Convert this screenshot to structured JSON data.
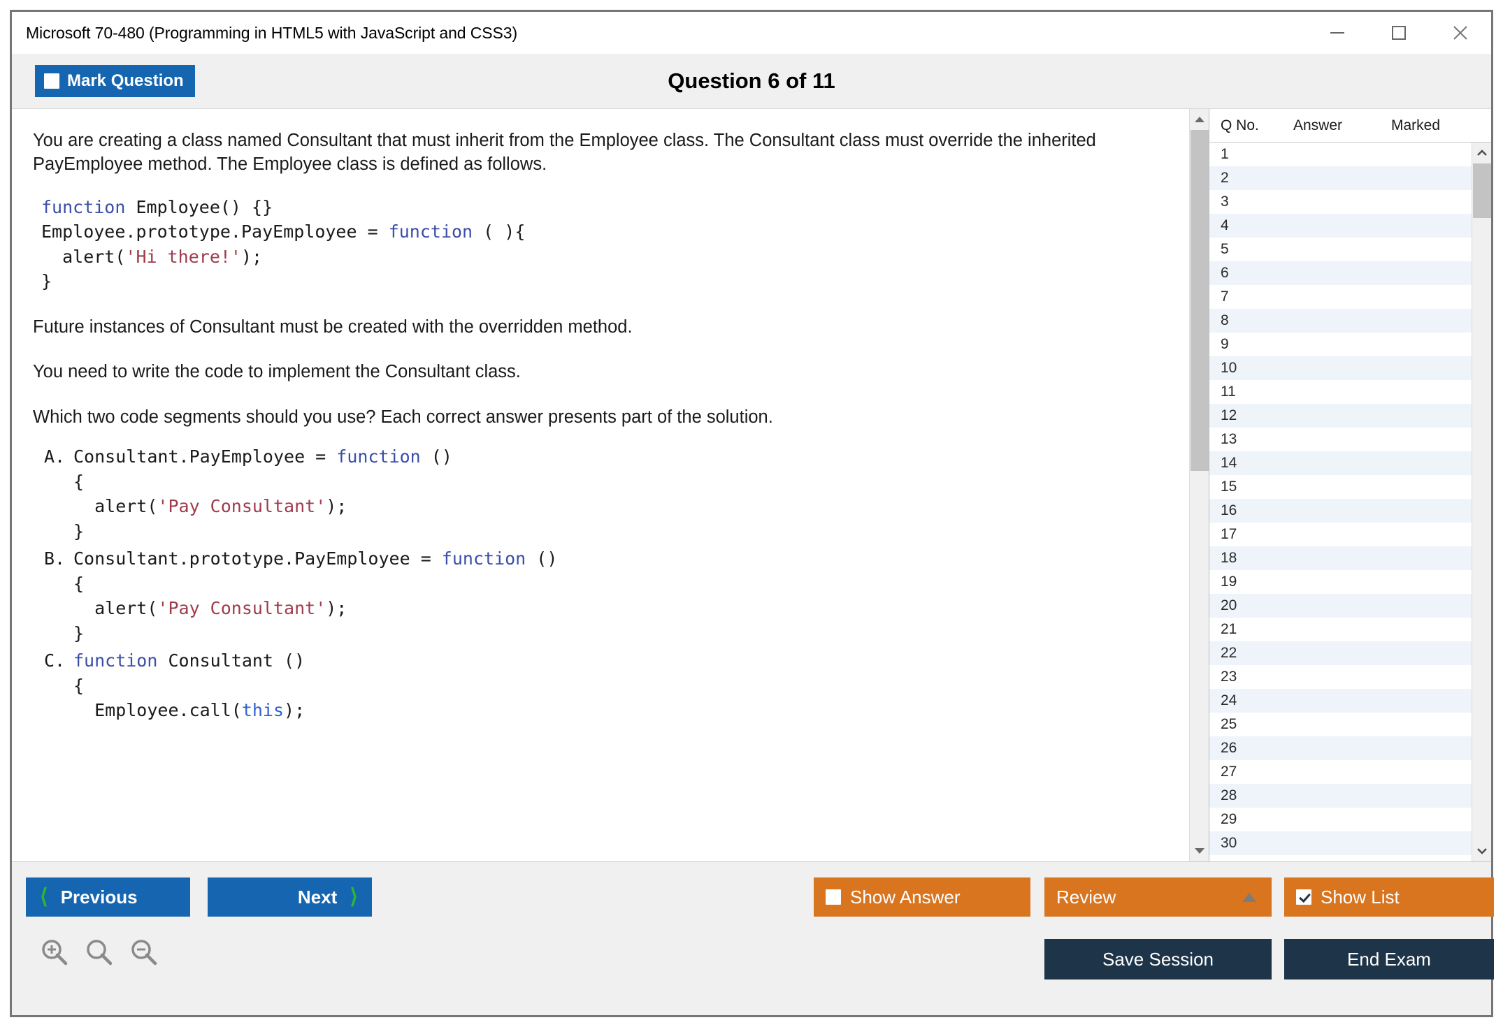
{
  "window": {
    "title": "Microsoft 70-480 (Programming in HTML5 with JavaScript and CSS3)",
    "controls": {
      "minimize": "minimize-icon",
      "maximize": "maximize-icon",
      "close": "close-icon"
    }
  },
  "header": {
    "mark_question_label": "Mark Question",
    "mark_question_checked": false,
    "question_heading": "Question 6 of 11"
  },
  "question": {
    "intro": "You are creating a class named Consultant that must inherit from the Employee class. The Consultant class must override the inherited PayEmployee method. The Employee class is defined as follows.",
    "code_lines": [
      {
        "parts": [
          {
            "t": "function ",
            "c": "kw"
          },
          {
            "t": "Employee() {}",
            "c": ""
          }
        ]
      },
      {
        "parts": [
          {
            "t": "Employee.prototype.PayEmployee = ",
            "c": ""
          },
          {
            "t": "function",
            "c": "kw"
          },
          {
            "t": " ( ){",
            "c": ""
          }
        ]
      },
      {
        "parts": [
          {
            "t": "  alert(",
            "c": ""
          },
          {
            "t": "'Hi there!'",
            "c": "str"
          },
          {
            "t": ");",
            "c": ""
          }
        ]
      },
      {
        "parts": [
          {
            "t": "}",
            "c": ""
          }
        ]
      }
    ],
    "para2": "Future instances of Consultant must be created with the overridden method.",
    "para3": "You need to write the code to implement the Consultant class.",
    "para4": "Which two code segments should you use? Each correct answer presents part of the solution."
  },
  "options": [
    {
      "letter": "A.",
      "lines": [
        {
          "parts": [
            {
              "t": "Consultant.PayEmployee = ",
              "c": ""
            },
            {
              "t": "function",
              "c": "kw"
            },
            {
              "t": " ()",
              "c": ""
            }
          ]
        },
        {
          "parts": [
            {
              "t": "{",
              "c": ""
            }
          ]
        },
        {
          "parts": [
            {
              "t": "  alert(",
              "c": ""
            },
            {
              "t": "'Pay Consultant'",
              "c": "str"
            },
            {
              "t": ");",
              "c": ""
            }
          ]
        },
        {
          "parts": [
            {
              "t": "}",
              "c": ""
            }
          ]
        }
      ]
    },
    {
      "letter": "B.",
      "lines": [
        {
          "parts": [
            {
              "t": "Consultant.prototype.PayEmployee = ",
              "c": ""
            },
            {
              "t": "function",
              "c": "kw"
            },
            {
              "t": " ()",
              "c": ""
            }
          ]
        },
        {
          "parts": [
            {
              "t": "{",
              "c": ""
            }
          ]
        },
        {
          "parts": [
            {
              "t": "  alert(",
              "c": ""
            },
            {
              "t": "'Pay Consultant'",
              "c": "str"
            },
            {
              "t": ");",
              "c": ""
            }
          ]
        },
        {
          "parts": [
            {
              "t": "}",
              "c": ""
            }
          ]
        }
      ]
    },
    {
      "letter": "C.",
      "lines": [
        {
          "parts": [
            {
              "t": "function",
              "c": "kw"
            },
            {
              "t": " Consultant ()",
              "c": ""
            }
          ]
        },
        {
          "parts": [
            {
              "t": "{",
              "c": ""
            }
          ]
        },
        {
          "parts": [
            {
              "t": "  Employee.call(",
              "c": ""
            },
            {
              "t": "this",
              "c": "blu"
            },
            {
              "t": ");",
              "c": ""
            }
          ]
        }
      ]
    }
  ],
  "question_list": {
    "columns": [
      "Q No.",
      "Answer",
      "Marked"
    ],
    "rows": [
      {
        "no": "1",
        "answer": "",
        "marked": ""
      },
      {
        "no": "2",
        "answer": "",
        "marked": ""
      },
      {
        "no": "3",
        "answer": "",
        "marked": ""
      },
      {
        "no": "4",
        "answer": "",
        "marked": ""
      },
      {
        "no": "5",
        "answer": "",
        "marked": ""
      },
      {
        "no": "6",
        "answer": "",
        "marked": ""
      },
      {
        "no": "7",
        "answer": "",
        "marked": ""
      },
      {
        "no": "8",
        "answer": "",
        "marked": ""
      },
      {
        "no": "9",
        "answer": "",
        "marked": ""
      },
      {
        "no": "10",
        "answer": "",
        "marked": ""
      },
      {
        "no": "11",
        "answer": "",
        "marked": ""
      },
      {
        "no": "12",
        "answer": "",
        "marked": ""
      },
      {
        "no": "13",
        "answer": "",
        "marked": ""
      },
      {
        "no": "14",
        "answer": "",
        "marked": ""
      },
      {
        "no": "15",
        "answer": "",
        "marked": ""
      },
      {
        "no": "16",
        "answer": "",
        "marked": ""
      },
      {
        "no": "17",
        "answer": "",
        "marked": ""
      },
      {
        "no": "18",
        "answer": "",
        "marked": ""
      },
      {
        "no": "19",
        "answer": "",
        "marked": ""
      },
      {
        "no": "20",
        "answer": "",
        "marked": ""
      },
      {
        "no": "21",
        "answer": "",
        "marked": ""
      },
      {
        "no": "22",
        "answer": "",
        "marked": ""
      },
      {
        "no": "23",
        "answer": "",
        "marked": ""
      },
      {
        "no": "24",
        "answer": "",
        "marked": ""
      },
      {
        "no": "25",
        "answer": "",
        "marked": ""
      },
      {
        "no": "26",
        "answer": "",
        "marked": ""
      },
      {
        "no": "27",
        "answer": "",
        "marked": ""
      },
      {
        "no": "28",
        "answer": "",
        "marked": ""
      },
      {
        "no": "29",
        "answer": "",
        "marked": ""
      },
      {
        "no": "30",
        "answer": "",
        "marked": ""
      }
    ]
  },
  "footer": {
    "previous_label": "Previous",
    "next_label": "Next",
    "show_answer_label": "Show Answer",
    "show_answer_checked": false,
    "review_label": "Review",
    "show_list_label": "Show List",
    "show_list_checked": true,
    "save_session_label": "Save Session",
    "end_exam_label": "End Exam",
    "zoom_icons": [
      "zoom-in-icon",
      "zoom-reset-icon",
      "zoom-out-icon"
    ]
  },
  "colors": {
    "blue_button": "#1565b0",
    "orange_button": "#d9741f",
    "navy_button": "#1d3449",
    "green_chevron": "#2db82d",
    "row_alt": "#eef4fa",
    "header_bg": "#f0f0f0"
  }
}
